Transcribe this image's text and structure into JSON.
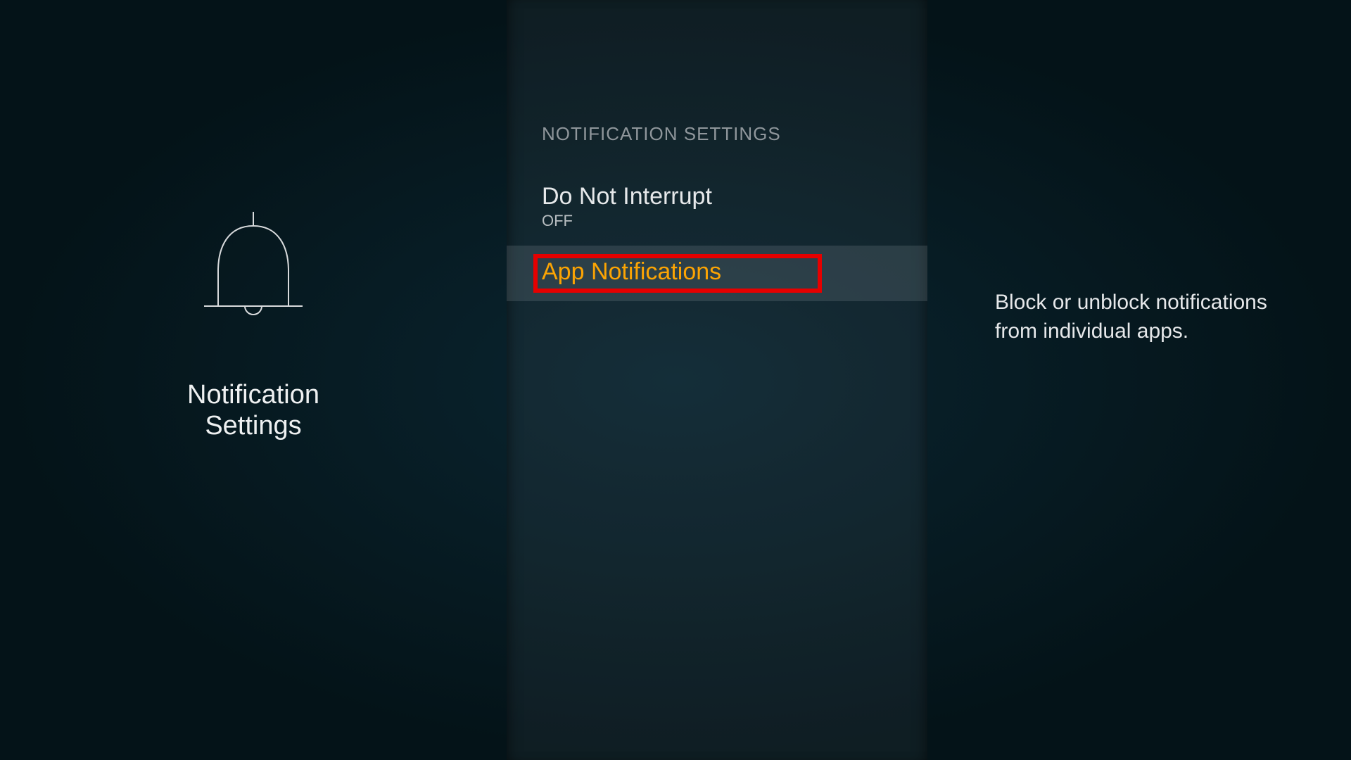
{
  "left": {
    "title_line1": "Notification",
    "title_line2": "Settings"
  },
  "middle": {
    "section_header": "NOTIFICATION SETTINGS",
    "items": [
      {
        "label": "Do Not Interrupt",
        "status": "OFF",
        "selected": false
      },
      {
        "label": "App Notifications",
        "status": "",
        "selected": true
      }
    ]
  },
  "right": {
    "description": "Block or unblock notifications from individual apps."
  },
  "colors": {
    "accent": "#fca403",
    "highlight": "#e60000"
  }
}
